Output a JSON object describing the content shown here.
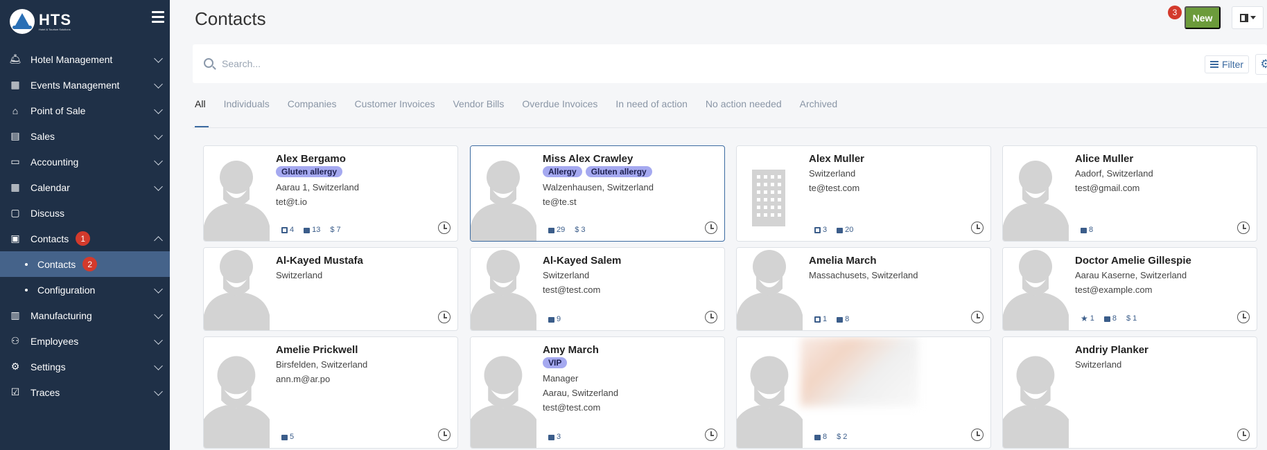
{
  "brand": {
    "name": "HTS",
    "subtitle": "Hotel & Tourism Solutions"
  },
  "sidebar": {
    "items": [
      {
        "label": "Hotel Management",
        "icon": "bell-icon"
      },
      {
        "label": "Events Management",
        "icon": "calendar-plus-icon"
      },
      {
        "label": "Point of Sale",
        "icon": "store-icon"
      },
      {
        "label": "Sales",
        "icon": "chart-icon"
      },
      {
        "label": "Accounting",
        "icon": "money-icon"
      },
      {
        "label": "Calendar",
        "icon": "calendar-icon"
      },
      {
        "label": "Discuss",
        "icon": "chat-icon"
      },
      {
        "label": "Contacts",
        "icon": "contacts-icon",
        "badge": "1"
      },
      {
        "label": "Contacts",
        "sub": true,
        "badge": "2"
      },
      {
        "label": "Configuration",
        "sub": true
      },
      {
        "label": "Manufacturing",
        "icon": "factory-icon"
      },
      {
        "label": "Employees",
        "icon": "people-icon"
      },
      {
        "label": "Settings",
        "icon": "gear-icon"
      },
      {
        "label": "Traces",
        "icon": "check-square-icon"
      }
    ]
  },
  "header": {
    "title": "Contacts",
    "new_label": "New",
    "notif_badge": "3"
  },
  "search": {
    "placeholder": "Search...",
    "filter_label": "Filter"
  },
  "tabs": [
    "All",
    "Individuals",
    "Companies",
    "Customer Invoices",
    "Vendor Bills",
    "Overdue Invoices",
    "In need of action",
    "No action needed",
    "Archived"
  ],
  "cards": [
    {
      "name": "Alex Bergamo",
      "tags": [
        "Gluten allergy"
      ],
      "lines": [
        "Aarau 1, Switzerland",
        "tet@t.io"
      ],
      "stats": [
        {
          "k": "cal",
          "v": "4"
        },
        {
          "k": "bag",
          "v": "13"
        },
        {
          "k": "dollar",
          "v": "7"
        }
      ]
    },
    {
      "name": "Miss Alex Crawley",
      "tags": [
        "Allergy",
        "Gluten allergy"
      ],
      "lines": [
        "Walzenhausen, Switzerland",
        "te@te.st"
      ],
      "stats": [
        {
          "k": "bag",
          "v": "29"
        },
        {
          "k": "dollar",
          "v": "3"
        }
      ]
    },
    {
      "name": "Alex Muller",
      "tags": [],
      "lines": [
        "Switzerland",
        "te@test.com"
      ],
      "stats": [
        {
          "k": "cal",
          "v": "3"
        },
        {
          "k": "bag",
          "v": "20"
        }
      ]
    },
    {
      "name": "Alice Muller",
      "tags": [],
      "lines": [
        "Aadorf, Switzerland",
        "test@gmail.com"
      ],
      "stats": [
        {
          "k": "bag",
          "v": "8"
        }
      ]
    },
    {
      "name": "Al-Kayed Mustafa",
      "tags": [],
      "lines": [
        "Switzerland"
      ],
      "stats": []
    },
    {
      "name": "Al-Kayed Salem",
      "tags": [],
      "lines": [
        "Switzerland",
        "test@test.com"
      ],
      "stats": [
        {
          "k": "bag",
          "v": "9"
        }
      ]
    },
    {
      "name": "Amelia March",
      "tags": [],
      "lines": [
        "Massachusets, Switzerland"
      ],
      "stats": [
        {
          "k": "cal",
          "v": "1"
        },
        {
          "k": "bag",
          "v": "8"
        }
      ]
    },
    {
      "name": "Doctor Amelie Gillespie",
      "tags": [],
      "lines": [
        "Aarau Kaserne, Switzerland",
        "test@example.com"
      ],
      "stats": [
        {
          "k": "star",
          "v": "1"
        },
        {
          "k": "bag",
          "v": "8"
        },
        {
          "k": "dollar",
          "v": "1"
        }
      ]
    },
    {
      "name": "Amelie Prickwell",
      "tags": [],
      "lines": [
        "Birsfelden, Switzerland",
        "ann.m@ar.po"
      ],
      "stats": [
        {
          "k": "bag",
          "v": "5"
        }
      ]
    },
    {
      "name": "Amy March",
      "tags": [
        "VIP"
      ],
      "lines": [
        "Manager",
        "Aarau, Switzerland",
        "test@test.com"
      ],
      "stats": [
        {
          "k": "bag",
          "v": "3"
        }
      ]
    },
    {
      "name": "",
      "tags": [],
      "lines": [],
      "stats": [
        {
          "k": "bag",
          "v": "8"
        },
        {
          "k": "dollar",
          "v": "2"
        }
      ]
    },
    {
      "name": "Andriy Planker",
      "tags": [],
      "lines": [
        "Switzerland"
      ],
      "stats": []
    }
  ]
}
